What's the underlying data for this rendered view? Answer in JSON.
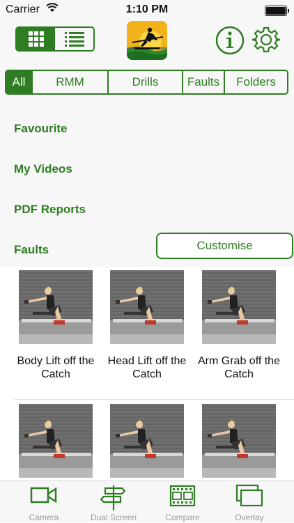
{
  "status_bar": {
    "carrier": "Carrier",
    "time": "1:10 PM"
  },
  "header": {
    "view_modes": [
      "grid",
      "list"
    ],
    "active_view": "grid"
  },
  "filters": {
    "items": [
      "All",
      "RMM",
      "Drills",
      "Faults",
      "Folders"
    ],
    "active": "All"
  },
  "menu": {
    "items": [
      "Favourite",
      "My Videos",
      "PDF Reports",
      "Faults"
    ],
    "customise_label": "Customise"
  },
  "videos": [
    {
      "title_line1": "Body Lift off the",
      "title_line2": "Catch"
    },
    {
      "title_line1": "Head Lift off the",
      "title_line2": "Catch"
    },
    {
      "title_line1": "Arm Grab off the",
      "title_line2": "Catch"
    },
    {
      "title_line1": "",
      "title_line2": ""
    },
    {
      "title_line1": "",
      "title_line2": ""
    },
    {
      "title_line1": "",
      "title_line2": ""
    }
  ],
  "tab_bar": {
    "items": [
      "Camera",
      "Dual Screen",
      "Compare",
      "Overlay"
    ]
  },
  "colors": {
    "accent": "#2e7d22",
    "background": "#f7f7f7",
    "tab_inactive": "#9a9a9a"
  }
}
